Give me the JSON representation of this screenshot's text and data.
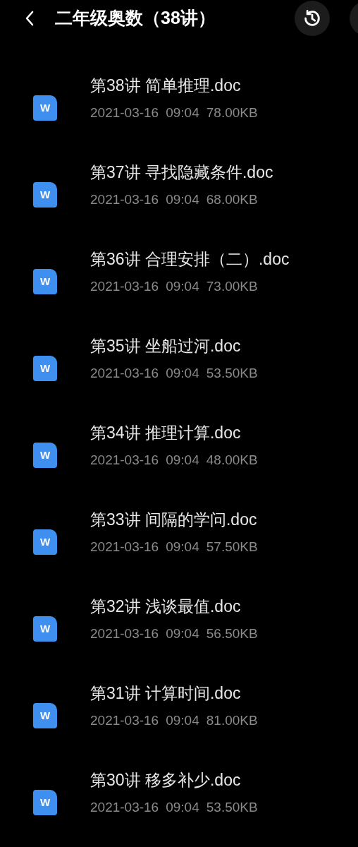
{
  "header": {
    "title": "二年级奥数（38讲）"
  },
  "files": [
    {
      "name": "第38讲 简单推理.doc",
      "date": "2021-03-16",
      "time": "09:04",
      "size": "78.00KB",
      "icon_letter": "W"
    },
    {
      "name": "第37讲 寻找隐藏条件.doc",
      "date": "2021-03-16",
      "time": "09:04",
      "size": "68.00KB",
      "icon_letter": "W"
    },
    {
      "name": "第36讲 合理安排（二）.doc",
      "date": "2021-03-16",
      "time": "09:04",
      "size": "73.00KB",
      "icon_letter": "W"
    },
    {
      "name": "第35讲 坐船过河.doc",
      "date": "2021-03-16",
      "time": "09:04",
      "size": "53.50KB",
      "icon_letter": "W"
    },
    {
      "name": "第34讲 推理计算.doc",
      "date": "2021-03-16",
      "time": "09:04",
      "size": "48.00KB",
      "icon_letter": "W"
    },
    {
      "name": "第33讲 间隔的学问.doc",
      "date": "2021-03-16",
      "time": "09:04",
      "size": "57.50KB",
      "icon_letter": "W"
    },
    {
      "name": "第32讲 浅谈最值.doc",
      "date": "2021-03-16",
      "time": "09:04",
      "size": "56.50KB",
      "icon_letter": "W"
    },
    {
      "name": "第31讲 计算时间.doc",
      "date": "2021-03-16",
      "time": "09:04",
      "size": "81.00KB",
      "icon_letter": "W"
    },
    {
      "name": "第30讲 移多补少.doc",
      "date": "2021-03-16",
      "time": "09:04",
      "size": "53.50KB",
      "icon_letter": "W"
    }
  ]
}
